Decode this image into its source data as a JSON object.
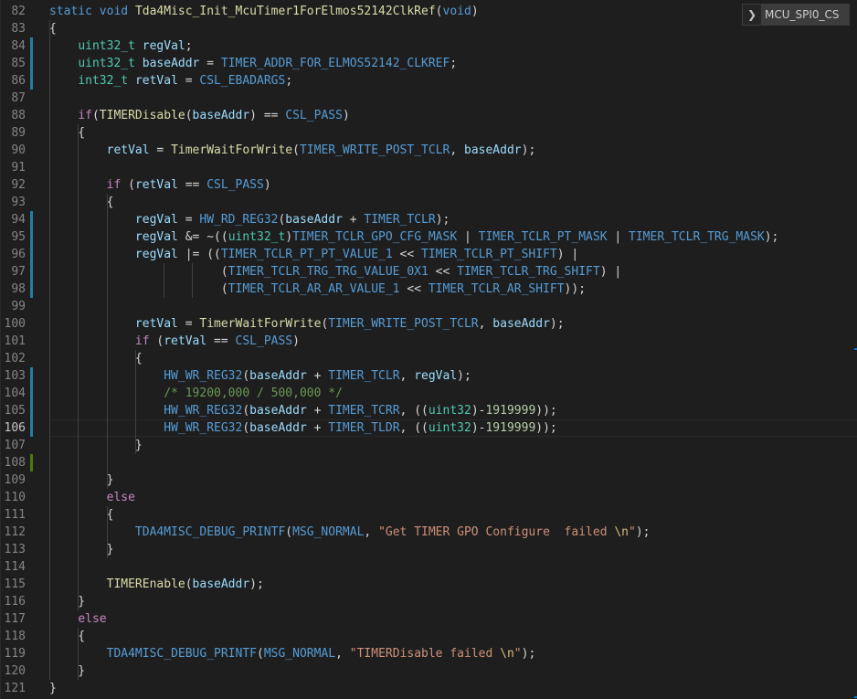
{
  "editor": {
    "active_line": "106",
    "breadcrumb_item": "MCU_SPI0_CS",
    "lines": [
      {
        "n": "82",
        "t": [
          [
            "kw",
            "static "
          ],
          [
            "kw",
            "void "
          ],
          [
            "fn",
            "Tda4Misc_Init_McuTimer1ForElmos52142ClkRef"
          ],
          [
            "op",
            "("
          ],
          [
            "kw",
            "void"
          ],
          [
            "op",
            ")"
          ]
        ]
      },
      {
        "n": "83",
        "t": [
          [
            "op",
            "{"
          ]
        ]
      },
      {
        "n": "84",
        "t": [
          [
            "op",
            "    "
          ],
          [
            "ty",
            "uint32_t "
          ],
          [
            "var",
            "regVal"
          ],
          [
            "op",
            ";"
          ]
        ]
      },
      {
        "n": "85",
        "t": [
          [
            "op",
            "    "
          ],
          [
            "ty",
            "uint32_t "
          ],
          [
            "var",
            "baseAddr"
          ],
          [
            "op",
            " = "
          ],
          [
            "mac",
            "TIMER_ADDR_FOR_ELMOS52142_CLKREF"
          ],
          [
            "op",
            ";"
          ]
        ]
      },
      {
        "n": "86",
        "t": [
          [
            "op",
            "    "
          ],
          [
            "ty",
            "int32_t "
          ],
          [
            "var",
            "retVal"
          ],
          [
            "op",
            " = "
          ],
          [
            "mac",
            "CSL_EBADARGS"
          ],
          [
            "op",
            ";"
          ]
        ]
      },
      {
        "n": "87",
        "t": []
      },
      {
        "n": "88",
        "t": [
          [
            "op",
            "    "
          ],
          [
            "ctl",
            "if"
          ],
          [
            "op",
            "("
          ],
          [
            "fn",
            "TIMERDisable"
          ],
          [
            "op",
            "("
          ],
          [
            "var",
            "baseAddr"
          ],
          [
            "op",
            ") == "
          ],
          [
            "mac",
            "CSL_PASS"
          ],
          [
            "op",
            ")"
          ]
        ]
      },
      {
        "n": "89",
        "t": [
          [
            "op",
            "    {"
          ]
        ]
      },
      {
        "n": "90",
        "t": [
          [
            "op",
            "        "
          ],
          [
            "var",
            "retVal"
          ],
          [
            "op",
            " = "
          ],
          [
            "fn",
            "TimerWaitForWrite"
          ],
          [
            "op",
            "("
          ],
          [
            "mac",
            "TIMER_WRITE_POST_TCLR"
          ],
          [
            "op",
            ", "
          ],
          [
            "var",
            "baseAddr"
          ],
          [
            "op",
            ");"
          ]
        ]
      },
      {
        "n": "91",
        "t": []
      },
      {
        "n": "92",
        "t": [
          [
            "op",
            "        "
          ],
          [
            "ctl",
            "if"
          ],
          [
            "op",
            " ("
          ],
          [
            "var",
            "retVal"
          ],
          [
            "op",
            " == "
          ],
          [
            "mac",
            "CSL_PASS"
          ],
          [
            "op",
            ")"
          ]
        ]
      },
      {
        "n": "93",
        "t": [
          [
            "op",
            "        {"
          ]
        ]
      },
      {
        "n": "94",
        "t": [
          [
            "op",
            "            "
          ],
          [
            "var",
            "regVal"
          ],
          [
            "op",
            " = "
          ],
          [
            "mac",
            "HW_RD_REG32"
          ],
          [
            "op",
            "("
          ],
          [
            "var",
            "baseAddr"
          ],
          [
            "op",
            " + "
          ],
          [
            "mac",
            "TIMER_TCLR"
          ],
          [
            "op",
            ");"
          ]
        ]
      },
      {
        "n": "95",
        "t": [
          [
            "op",
            "            "
          ],
          [
            "var",
            "regVal"
          ],
          [
            "op",
            " &= ~(("
          ],
          [
            "ty",
            "uint32_t"
          ],
          [
            "op",
            ")"
          ],
          [
            "mac",
            "TIMER_TCLR_GPO_CFG_MASK"
          ],
          [
            "op",
            " | "
          ],
          [
            "mac",
            "TIMER_TCLR_PT_MASK"
          ],
          [
            "op",
            " | "
          ],
          [
            "mac",
            "TIMER_TCLR_TRG_MASK"
          ],
          [
            "op",
            ");"
          ]
        ]
      },
      {
        "n": "96",
        "t": [
          [
            "op",
            "            "
          ],
          [
            "var",
            "regVal"
          ],
          [
            "op",
            " |= (("
          ],
          [
            "mac",
            "TIMER_TCLR_PT_PT_VALUE_1"
          ],
          [
            "op",
            " << "
          ],
          [
            "mac",
            "TIMER_TCLR_PT_SHIFT"
          ],
          [
            "op",
            ") |"
          ]
        ]
      },
      {
        "n": "97",
        "t": [
          [
            "op",
            "                        ("
          ],
          [
            "mac",
            "TIMER_TCLR_TRG_TRG_VALUE_0X1"
          ],
          [
            "op",
            " << "
          ],
          [
            "mac",
            "TIMER_TCLR_TRG_SHIFT"
          ],
          [
            "op",
            ") |"
          ]
        ]
      },
      {
        "n": "98",
        "t": [
          [
            "op",
            "                        ("
          ],
          [
            "mac",
            "TIMER_TCLR_AR_AR_VALUE_1"
          ],
          [
            "op",
            " << "
          ],
          [
            "mac",
            "TIMER_TCLR_AR_SHIFT"
          ],
          [
            "op",
            "));"
          ]
        ]
      },
      {
        "n": "99",
        "t": []
      },
      {
        "n": "100",
        "t": [
          [
            "op",
            "            "
          ],
          [
            "var",
            "retVal"
          ],
          [
            "op",
            " = "
          ],
          [
            "fn",
            "TimerWaitForWrite"
          ],
          [
            "op",
            "("
          ],
          [
            "mac",
            "TIMER_WRITE_POST_TCLR"
          ],
          [
            "op",
            ", "
          ],
          [
            "var",
            "baseAddr"
          ],
          [
            "op",
            ");"
          ]
        ]
      },
      {
        "n": "101",
        "t": [
          [
            "op",
            "            "
          ],
          [
            "ctl",
            "if"
          ],
          [
            "op",
            " ("
          ],
          [
            "var",
            "retVal"
          ],
          [
            "op",
            " == "
          ],
          [
            "mac",
            "CSL_PASS"
          ],
          [
            "op",
            ")"
          ]
        ]
      },
      {
        "n": "102",
        "t": [
          [
            "op",
            "            {"
          ]
        ]
      },
      {
        "n": "103",
        "t": [
          [
            "op",
            "                "
          ],
          [
            "mac",
            "HW_WR_REG32"
          ],
          [
            "op",
            "("
          ],
          [
            "var",
            "baseAddr"
          ],
          [
            "op",
            " + "
          ],
          [
            "mac",
            "TIMER_TCLR"
          ],
          [
            "op",
            ", "
          ],
          [
            "var",
            "regVal"
          ],
          [
            "op",
            ");"
          ]
        ]
      },
      {
        "n": "104",
        "t": [
          [
            "op",
            "                "
          ],
          [
            "cmt",
            "/* 19200,000 / 500,000 */"
          ]
        ]
      },
      {
        "n": "105",
        "t": [
          [
            "op",
            "                "
          ],
          [
            "mac",
            "HW_WR_REG32"
          ],
          [
            "op",
            "("
          ],
          [
            "var",
            "baseAddr"
          ],
          [
            "op",
            " + "
          ],
          [
            "mac",
            "TIMER_TCRR"
          ],
          [
            "op",
            ", (("
          ],
          [
            "ty",
            "uint32"
          ],
          [
            "op",
            ")-"
          ],
          [
            "num",
            "1919999"
          ],
          [
            "op",
            "));"
          ]
        ]
      },
      {
        "n": "106",
        "t": [
          [
            "op",
            "                "
          ],
          [
            "mac",
            "HW_WR_REG32"
          ],
          [
            "op",
            "("
          ],
          [
            "var",
            "baseAddr"
          ],
          [
            "op",
            " + "
          ],
          [
            "mac",
            "TIMER_TLDR"
          ],
          [
            "op",
            ", (("
          ],
          [
            "ty",
            "uint32"
          ],
          [
            "op",
            ")-"
          ],
          [
            "num",
            "1919999"
          ],
          [
            "op",
            "));"
          ]
        ]
      },
      {
        "n": "107",
        "t": [
          [
            "op",
            "            }"
          ]
        ]
      },
      {
        "n": "108",
        "t": []
      },
      {
        "n": "109",
        "t": [
          [
            "op",
            "        }"
          ]
        ]
      },
      {
        "n": "110",
        "t": [
          [
            "op",
            "        "
          ],
          [
            "ctl",
            "else"
          ]
        ]
      },
      {
        "n": "111",
        "t": [
          [
            "op",
            "        {"
          ]
        ]
      },
      {
        "n": "112",
        "t": [
          [
            "op",
            "            "
          ],
          [
            "mac",
            "TDA4MISC_DEBUG_PRINTF"
          ],
          [
            "op",
            "("
          ],
          [
            "mac",
            "MSG_NORMAL"
          ],
          [
            "op",
            ", "
          ],
          [
            "str",
            "\"Get TIMER GPO Configure  failed "
          ],
          [
            "esc",
            "\\n"
          ],
          [
            "str",
            "\""
          ],
          [
            "op",
            ");"
          ]
        ]
      },
      {
        "n": "113",
        "t": [
          [
            "op",
            "        }"
          ]
        ]
      },
      {
        "n": "114",
        "t": []
      },
      {
        "n": "115",
        "t": [
          [
            "op",
            "        "
          ],
          [
            "fn",
            "TIMEREnable"
          ],
          [
            "op",
            "("
          ],
          [
            "var",
            "baseAddr"
          ],
          [
            "op",
            ");"
          ]
        ]
      },
      {
        "n": "116",
        "t": [
          [
            "op",
            "    }"
          ]
        ]
      },
      {
        "n": "117",
        "t": [
          [
            "op",
            "    "
          ],
          [
            "ctl",
            "else"
          ]
        ]
      },
      {
        "n": "118",
        "t": [
          [
            "op",
            "    {"
          ]
        ]
      },
      {
        "n": "119",
        "t": [
          [
            "op",
            "        "
          ],
          [
            "mac",
            "TDA4MISC_DEBUG_PRINTF"
          ],
          [
            "op",
            "("
          ],
          [
            "mac",
            "MSG_NORMAL"
          ],
          [
            "op",
            ", "
          ],
          [
            "str",
            "\"TIMERDisable failed "
          ],
          [
            "esc",
            "\\n"
          ],
          [
            "str",
            "\""
          ],
          [
            "op",
            ");"
          ]
        ]
      },
      {
        "n": "120",
        "t": [
          [
            "op",
            "    }"
          ]
        ]
      },
      {
        "n": "121",
        "t": [
          [
            "op",
            "}"
          ]
        ]
      }
    ],
    "modified_lines": [
      "84",
      "85",
      "86",
      "94",
      "95",
      "96",
      "97",
      "98",
      "103",
      "104",
      "105",
      "106"
    ],
    "added_lines": [
      "108"
    ]
  }
}
